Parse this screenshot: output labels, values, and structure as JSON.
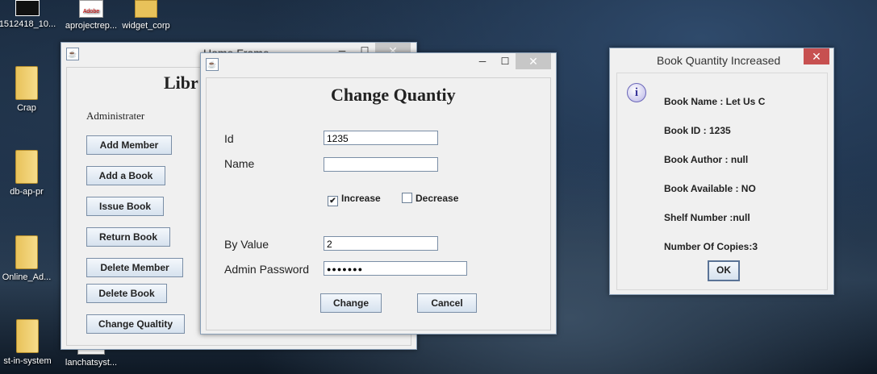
{
  "desktop": {
    "icons": [
      {
        "label": "1512418_10..."
      },
      {
        "label": "aprojectrep..."
      },
      {
        "label": "widget_corp"
      },
      {
        "label": "Crap"
      },
      {
        "label": "db-ap-pr"
      },
      {
        "label": "Online_Ad..."
      },
      {
        "label": "st-in-system"
      },
      {
        "label": "lanchatsyst..."
      }
    ],
    "adobe_text": "Adobe"
  },
  "home_frame": {
    "title": "Home Frame",
    "heading": "Libr",
    "section_label": "Administrater",
    "buttons": [
      "Add Member",
      "Add a Book",
      "Issue Book",
      "Return Book",
      "Delete Member",
      "Delete Book",
      "Change Qualtity"
    ]
  },
  "change_dialog": {
    "heading": "Change Quantiy",
    "id_label": "Id",
    "id_value": "1235",
    "name_label": "Name",
    "name_value": "",
    "increase_label": "Increase",
    "increase_checked": true,
    "decrease_label": "Decrease",
    "decrease_checked": false,
    "by_value_label": "By Value",
    "by_value": "2",
    "admin_password_label": "Admin Password",
    "admin_password_mask": "●●●●●●●",
    "change_label": "Change",
    "cancel_label": "Cancel"
  },
  "message": {
    "title": "Book Quantity Increased",
    "lines": [
      "Book Name : Let Us C",
      "Book ID : 1235",
      "Book Author : null",
      "Book Available : NO",
      "Shelf Number :null",
      "Number Of Copies:3"
    ],
    "ok_label": "OK"
  },
  "icons": {
    "minimize": "─",
    "maximize": "☐",
    "close": "✕",
    "check": "✔",
    "info": "i"
  }
}
